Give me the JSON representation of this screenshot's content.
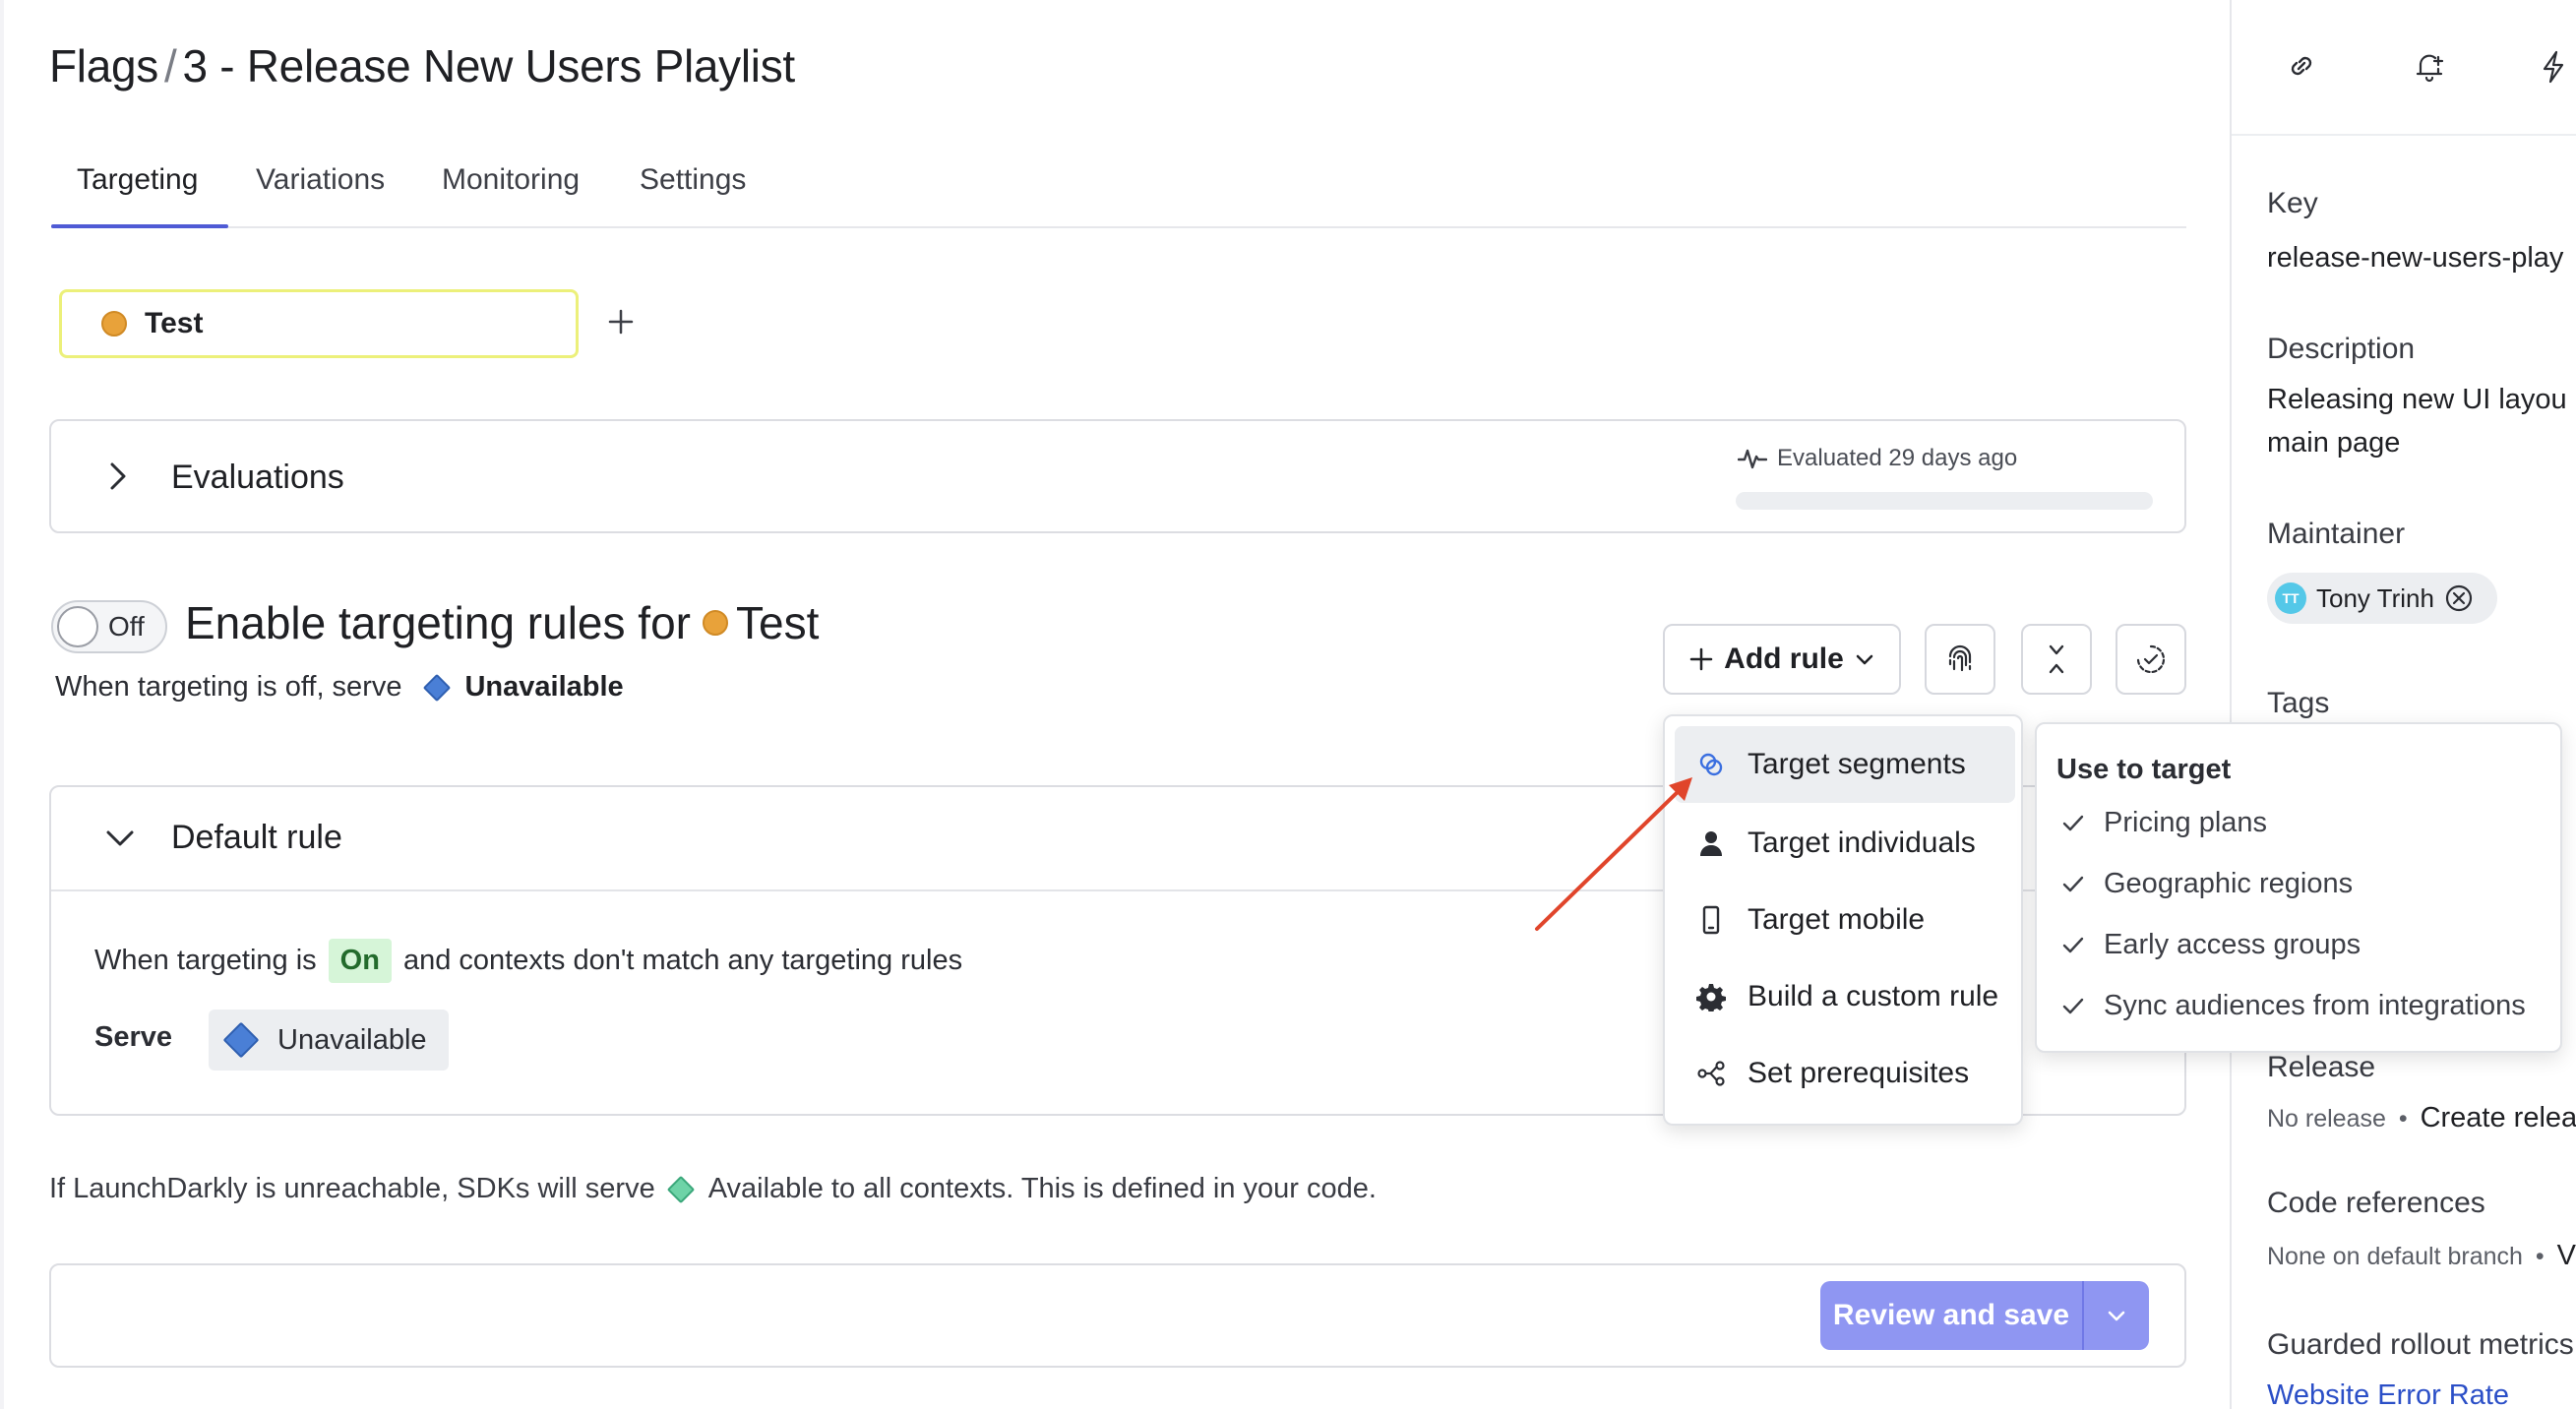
{
  "header": {
    "breadcrumb_root": "Flags",
    "separator": "/",
    "flag_name": "3 - Release New Users Playlist"
  },
  "tabs": [
    {
      "label": "Targeting",
      "active": true
    },
    {
      "label": "Variations",
      "active": false
    },
    {
      "label": "Monitoring",
      "active": false
    },
    {
      "label": "Settings",
      "active": false
    }
  ],
  "environment": {
    "name": "Test",
    "color": "#e8a23a"
  },
  "evaluations": {
    "title": "Evaluations",
    "meta": "Evaluated 29 days ago"
  },
  "targeting": {
    "toggle_label": "Off",
    "heading": "Enable targeting rules for",
    "env_name": "Test",
    "off_serve_text": "When targeting is off, serve",
    "off_variation": "Unavailable"
  },
  "toolbar": {
    "add_rule_label": "Add rule"
  },
  "default_rule": {
    "title": "Default rule",
    "when_prefix": "When targeting is",
    "on_badge": "On",
    "when_suffix": "and contexts don't match any targeting rules",
    "serve_label": "Serve",
    "serve_variation": "Unavailable"
  },
  "fallback": {
    "prefix": "If LaunchDarkly is unreachable, SDKs will serve",
    "variation": "Available to all contexts. This is defined in your code."
  },
  "review": {
    "label": "Review and save",
    "color": "#8f96f2"
  },
  "add_rule_menu": {
    "items": [
      {
        "label": "Target segments",
        "icon": "segments-icon",
        "highlighted": true
      },
      {
        "label": "Target individuals",
        "icon": "person-icon",
        "highlighted": false
      },
      {
        "label": "Target mobile",
        "icon": "mobile-icon",
        "highlighted": false
      },
      {
        "label": "Build a custom rule",
        "icon": "gear-icon",
        "highlighted": false
      },
      {
        "label": "Set prerequisites",
        "icon": "prerequisites-icon",
        "highlighted": false
      }
    ],
    "submenu": {
      "title": "Use to target",
      "items": [
        "Pricing plans",
        "Geographic regions",
        "Early access groups",
        "Sync audiences from integrations"
      ]
    }
  },
  "sidebar": {
    "key_label": "Key",
    "key_value": "release-new-users-play",
    "description_label": "Description",
    "description_line1": "Releasing new UI layou",
    "description_line2": "main page",
    "maintainer_label": "Maintainer",
    "maintainer_initials": "TT",
    "maintainer_name": "Tony Trinh",
    "tags_label": "Tags",
    "release_label": "Release",
    "release_status": "No release",
    "release_action": "Create relea",
    "code_refs_label": "Code references",
    "code_refs_status": "None on default branch",
    "code_refs_trail": "V",
    "guarded_label": "Guarded rollout metrics",
    "guarded_link": "Website Error Rate"
  },
  "colors": {
    "accent": "#4f5bd5",
    "on_badge_bg": "#d6f5d8",
    "annotation_arrow": "#e0452b"
  }
}
